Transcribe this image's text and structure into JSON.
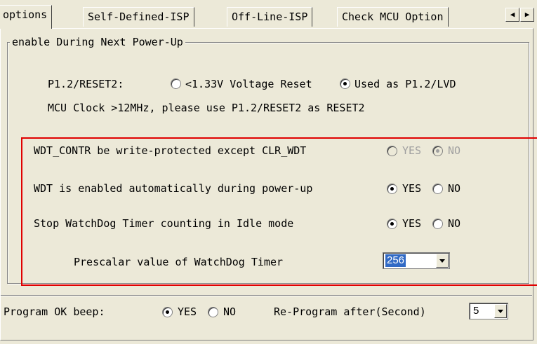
{
  "tabs": [
    "options",
    "Self-Defined-ISP",
    "Off-Line-ISP",
    "Check MCU Option"
  ],
  "tab_scroll": {
    "left": "◀",
    "right": "▶"
  },
  "group": {
    "label": "enable During Next Power-Up",
    "p12_label": "P1.2/RESET2:",
    "p12_opt1": "<1.33V Voltage Reset",
    "p12_opt2": "Used as P1.2/LVD",
    "clock_note": "MCU Clock >12MHz, please use P1.2/RESET2 as RESET2",
    "wdt_protect": {
      "label": "WDT_CONTR be write-protected except CLR_WDT",
      "yes": "YES",
      "no": "NO"
    },
    "wdt_enable": {
      "label": "WDT is enabled automatically during power-up",
      "yes": "YES",
      "no": "NO"
    },
    "wdt_idle": {
      "label": "Stop WatchDog Timer counting in Idle mode",
      "yes": "YES",
      "no": "NO"
    },
    "prescalar": {
      "label": "Prescalar value of WatchDog Timer",
      "value": "256"
    }
  },
  "footer": {
    "beep_label": "Program OK beep:",
    "yes": "YES",
    "no": "NO",
    "reprogram_label": "Re-Program after(Second)",
    "reprogram_value": "5"
  },
  "colors": {
    "highlight_box": "#e00000",
    "selection": "#316ac5"
  }
}
